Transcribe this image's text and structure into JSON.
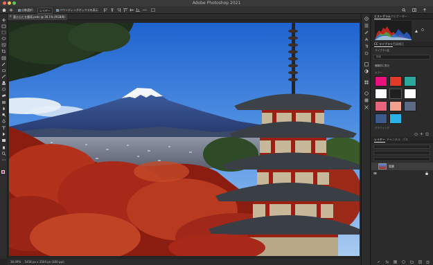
{
  "window": {
    "title": "Adobe Photoshop 2021"
  },
  "options_bar": {
    "auto_select_label": "自動選択：",
    "auto_select_target": "レイヤー",
    "transform_controls_label": "バウンディングボックスを表示"
  },
  "document": {
    "tab_title": "富士山と五重塔.psdc @ 36.1% (RGB/8)",
    "close_symbol": "×"
  },
  "status_bar": {
    "zoom": "36.09%",
    "doc_info": "5458 px x 3504 px (300 ppi)"
  },
  "panels": {
    "top_tabs": [
      "ヒストグラム",
      "ナビゲーター"
    ],
    "library_tabs": [
      "CC ライブラリ",
      "色調補正"
    ],
    "library_user": "ライブラリ名",
    "library_search_placeholder": "検索",
    "library_view": "種類別に表示",
    "colors_section": "カラー",
    "more_section": "グラフィック",
    "layer_tabs": [
      "レイヤー",
      "チャンネル",
      "パス"
    ],
    "layer_name": "背景"
  },
  "colors": {
    "swatches": [
      "#e8107a",
      "#e03a2a",
      "#2da89c",
      "#ffffff",
      "#1f1f1f",
      "#ffffff",
      "#e8637c",
      "#f2a18f",
      "#5c6a86",
      "#3d5a8c",
      "#2ab2e8"
    ],
    "foreground": "#e8107a",
    "background": "#ffffff",
    "accent": "#5a8ee0"
  },
  "icons": {
    "toolbar": [
      "move-icon",
      "artboard-icon",
      "marquee-icon",
      "lasso-icon",
      "object-select-icon",
      "crop-icon",
      "frame-icon",
      "eyedropper-icon",
      "healing-icon",
      "brush-icon",
      "clone-stamp-icon",
      "history-brush-icon",
      "eraser-icon",
      "gradient-icon",
      "blur-icon",
      "dodge-icon",
      "pen-icon",
      "type-icon",
      "path-select-icon",
      "rectangle-icon",
      "hand-icon",
      "zoom-icon",
      "more-tools-icon"
    ]
  }
}
